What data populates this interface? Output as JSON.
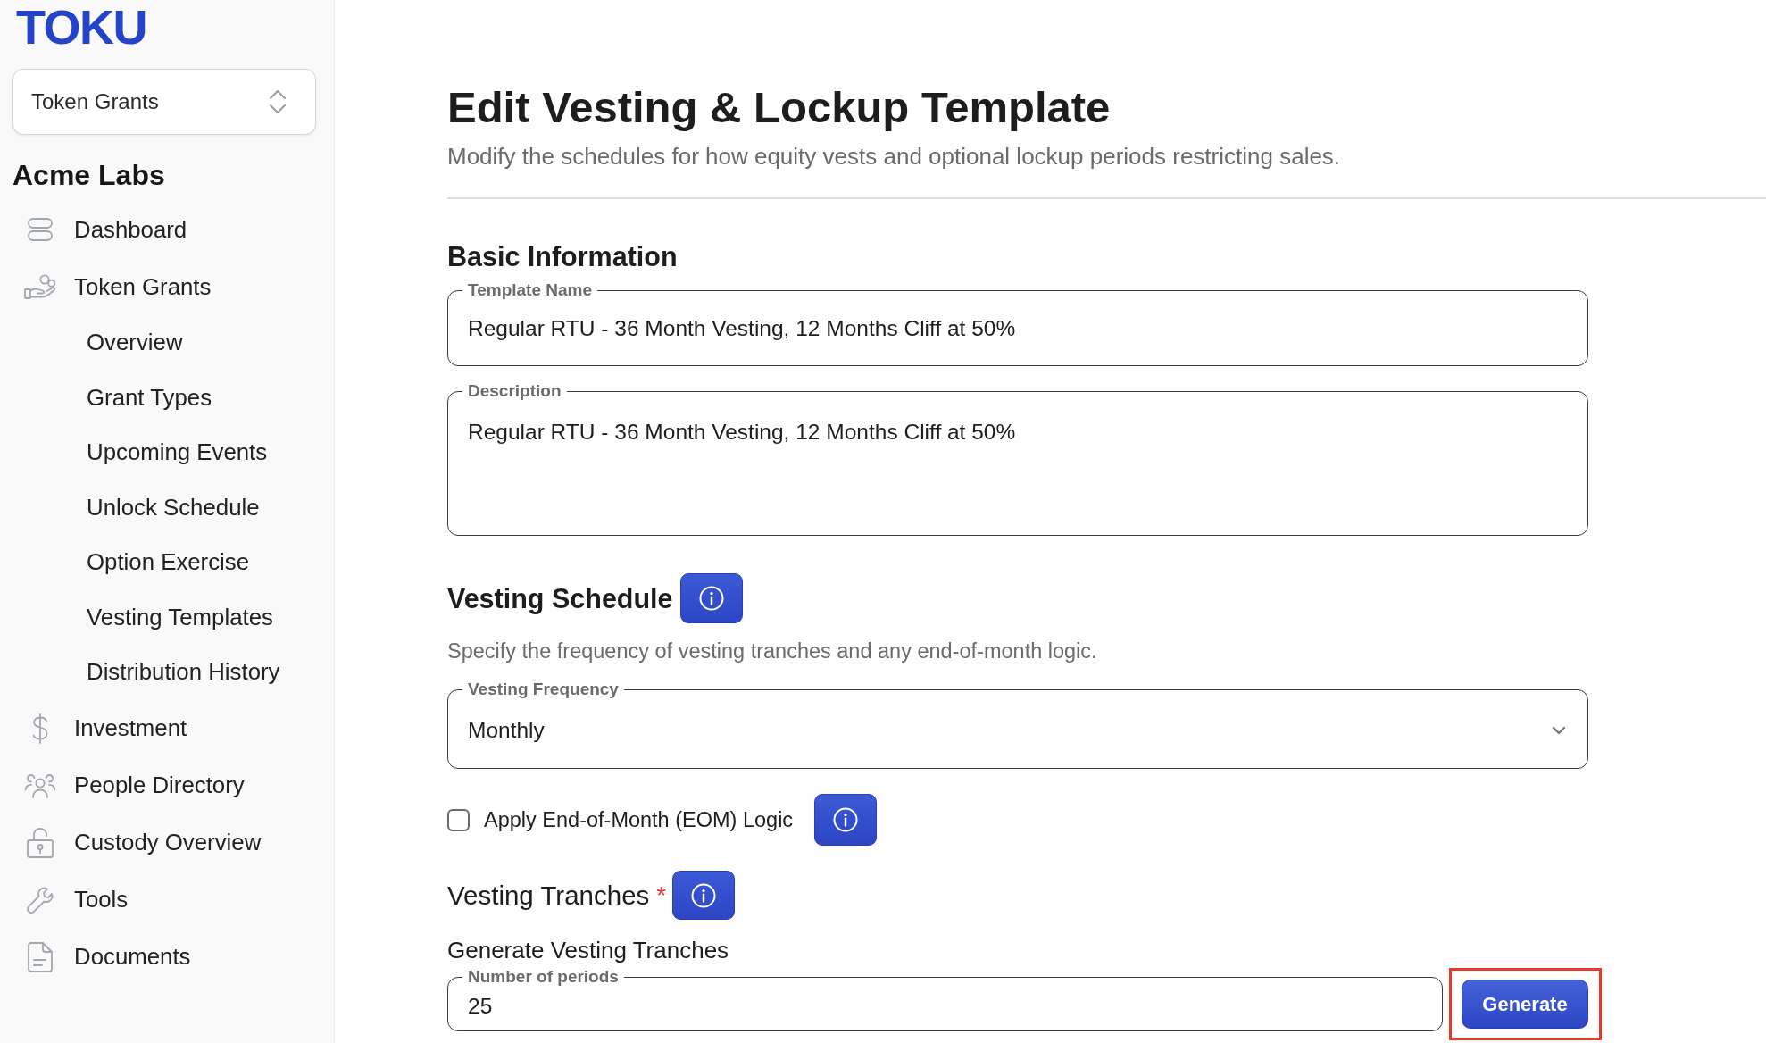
{
  "sidebar": {
    "logo": "TOKU",
    "product_switcher": {
      "value": "Token Grants"
    },
    "organization": "Acme Labs",
    "items": [
      {
        "label": "Dashboard"
      },
      {
        "label": "Token Grants",
        "children": [
          {
            "label": "Overview"
          },
          {
            "label": "Grant Types"
          },
          {
            "label": "Upcoming Events"
          },
          {
            "label": "Unlock Schedule"
          },
          {
            "label": "Option Exercise"
          },
          {
            "label": "Vesting Templates"
          },
          {
            "label": "Distribution History"
          }
        ]
      },
      {
        "label": "Investment"
      },
      {
        "label": "People Directory"
      },
      {
        "label": "Custody Overview"
      },
      {
        "label": "Tools"
      },
      {
        "label": "Documents"
      }
    ]
  },
  "header": {
    "title": "Edit Vesting & Lockup Template",
    "subtitle": "Modify the schedules for how equity vests and optional lockup periods restricting sales."
  },
  "basic_information": {
    "heading": "Basic Information",
    "fields": [
      {
        "kind": "text",
        "label": "Template Name",
        "value": "Regular RTU - 36 Month Vesting, 12 Months Cliff at 50%"
      },
      {
        "kind": "textarea",
        "label": "Description",
        "value": "Regular RTU - 36 Month Vesting, 12 Months Cliff at 50%"
      }
    ]
  },
  "vesting_schedule": {
    "heading": "Vesting Schedule",
    "info": true,
    "description": "Specify the frequency of vesting tranches and any end-of-month logic.",
    "frequency": {
      "kind": "select",
      "label": "Vesting Frequency",
      "value": "Monthly"
    },
    "eom_checkbox": {
      "label": "Apply End-of-Month (EOM) Logic",
      "checked": false,
      "info": true
    }
  },
  "vesting_tranches": {
    "heading": "Vesting Tranches",
    "required_mark": "*",
    "info": true,
    "subheading": "Generate Vesting Tranches",
    "periods": {
      "kind": "number",
      "label": "Number of periods",
      "value": "25"
    },
    "generate_button": {
      "label": "Generate",
      "highlighted": true
    }
  }
}
